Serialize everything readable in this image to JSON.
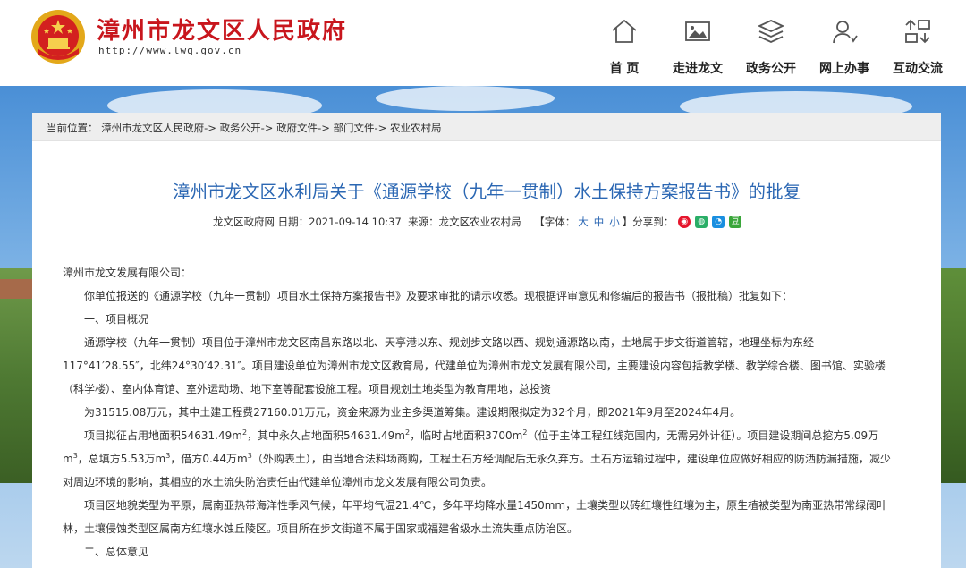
{
  "header": {
    "site_title": "漳州市龙文区人民政府",
    "site_url": "http://www.lwq.gov.cn",
    "nav": [
      {
        "label": "首  页",
        "icon": "home-icon"
      },
      {
        "label": "走进龙文",
        "icon": "picture-icon"
      },
      {
        "label": "政务公开",
        "icon": "layers-icon"
      },
      {
        "label": "网上办事",
        "icon": "user-icon"
      },
      {
        "label": "互动交流",
        "icon": "exchange-icon"
      }
    ]
  },
  "breadcrumb": {
    "prefix": "当前位置：",
    "items": [
      "漳州市龙文区人民政府",
      "政务公开",
      "政府文件",
      "部门文件",
      "农业农村局"
    ],
    "separator": "->"
  },
  "article": {
    "title": "漳州市龙文区水利局关于《通源学校（九年一贯制）水土保持方案报告书》的批复",
    "meta": {
      "source_site": "龙文区政府网",
      "date_label": "日期：",
      "date": "2021-09-14 10:37",
      "source_label": "来源：",
      "source": "龙文区农业农村局",
      "font_label": "【字体：",
      "font_large": "大",
      "font_medium": "中",
      "font_small": "小",
      "font_close": "】",
      "share_label": "分享到："
    },
    "paragraphs": {
      "salutation": "漳州市龙文发展有限公司：",
      "intro": "你单位报送的《通源学校（九年一贯制）项目水土保持方案报告书》及要求审批的请示收悉。现根据评审意见和修编后的报告书（报批稿）批复如下：",
      "sec1_heading": "一、项目概况",
      "p1_line1": "通源学校（九年一贯制）项目位于漳州市龙文区南昌东路以北、天亭港以东、规划步文路以西、规划通源路以南，土地属于步文街道管辖，地理坐标为东经",
      "p1_line2": "117°41′28.55″，北纬24°30′42.31″。项目建设单位为漳州市龙文区教育局，代建单位为漳州市龙文发展有限公司，主要建设内容包括教学楼、教学综合楼、图书馆、实验楼",
      "p1_line3": "（科学楼）、室内体育馆、室外运动场、地下室等配套设施工程。项目规划土地类型为教育用地，总投资",
      "p1_line4": "为31515.08万元，其中土建工程费27160.01万元，资金来源为业主多渠道筹集。建设期限拟定为32个月，即2021年9月至2024年4月。",
      "p2_line1_a": "项目拟征占用地面积54631.49m",
      "p2_line1_b": "，其中永久占地面积54631.49m",
      "p2_line1_c": "，临时占地面积3700m",
      "p2_line1_d": "（位于主体工程红线范围内，无需另外计征）。项目建设期间总挖方5.09万",
      "p2_line2_a": "m",
      "p2_line2_b": "，总填方5.53万m",
      "p2_line2_c": "，借方0.44万m",
      "p2_line2_d": "（外购表土），由当地合法料场商购，工程土石方经调配后无永久弃方。土石方运输过程中，建设单位应做好相应的防洒防漏措施，减少",
      "p2_line3": "对周边环境的影响，其相应的水土流失防治责任由代建单位漳州市龙文发展有限公司负责。",
      "sup2": "2",
      "sup3": "3",
      "p3_line1": "项目区地貌类型为平原，属南亚热带海洋性季风气候，年平均气温21.4℃，多年平均降水量1450mm，土壤类型以砖红壤性红壤为主，原生植被类型为南亚热带常绿阔叶",
      "p3_line2": "林，土壤侵蚀类型区属南方红壤水蚀丘陵区。项目所在步文街道不属于国家或福建省级水土流失重点防治区。",
      "sec2_heading": "二、总体意见"
    }
  },
  "colors": {
    "brand_red": "#c8161d",
    "title_blue": "#2b67b3"
  }
}
